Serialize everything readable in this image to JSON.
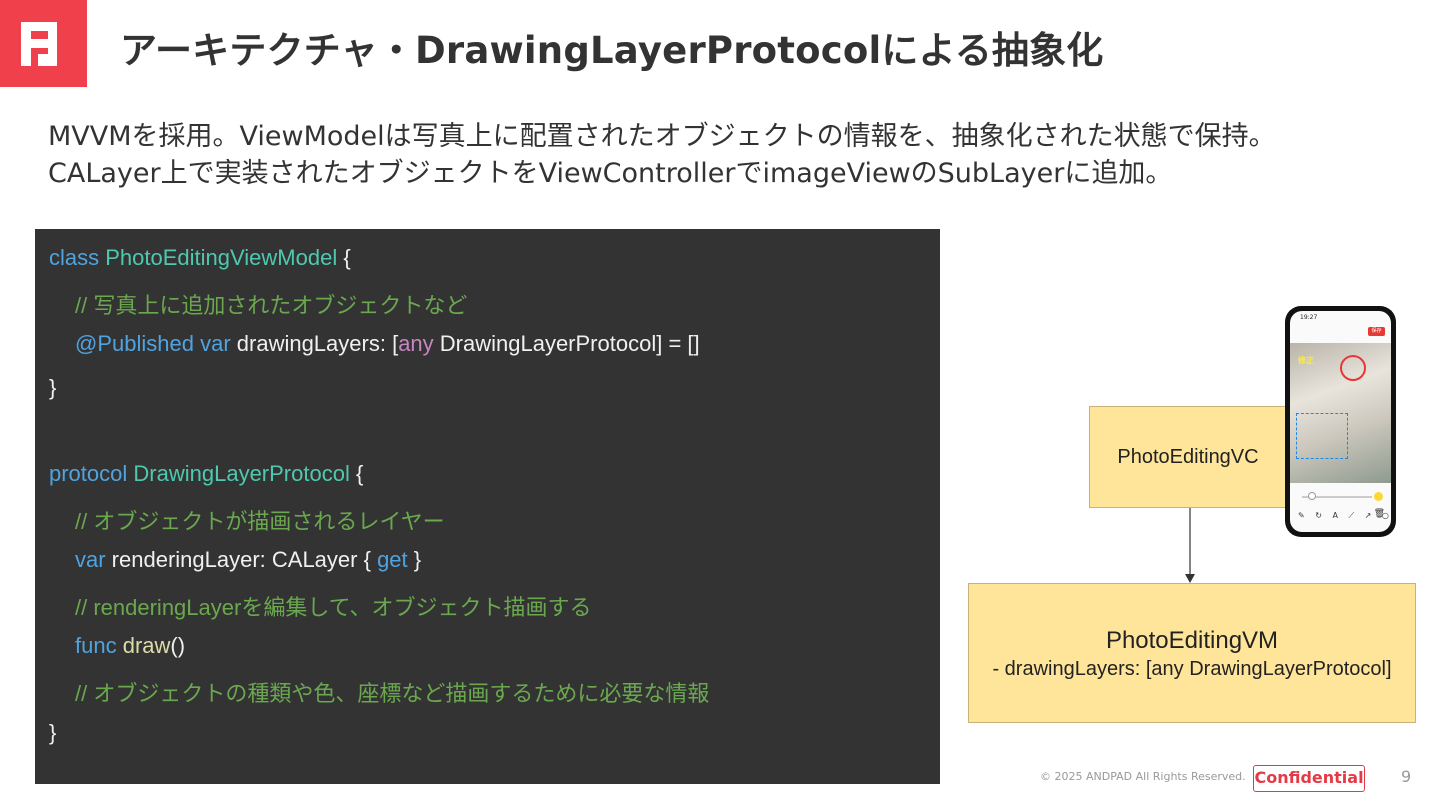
{
  "colors": {
    "brand": "#f0404c",
    "code_bg": "#333333",
    "box_fill": "#ffe599"
  },
  "logo": {
    "icon": "andpad-logo-icon"
  },
  "header": {
    "title": "アーキテクチャ・DrawingLayerProtocolによる抽象化"
  },
  "description": {
    "line1": "MVVMを採用。ViewModelは写真上に配置されたオブジェクトの情報を、抽象化された状態で保持。",
    "line2": "CALayer上で実装されたオブジェクトをViewControllerでimageViewのSubLayerに追加。"
  },
  "code": {
    "l1": {
      "kw": "class",
      "type": "PhotoEditingViewModel",
      "rest": " {"
    },
    "l2": {
      "comment": "// 写真上に追加されたオブジェクトなど"
    },
    "l3": {
      "attr": "@Published",
      "kw": "var",
      "name": " drawingLayers: [",
      "kw2": "any",
      "rest": " DrawingLayerProtocol] = []"
    },
    "l4": {
      "text": "}"
    },
    "l5": {
      "kw": "protocol",
      "type": "DrawingLayerProtocol",
      "rest": " {"
    },
    "l6": {
      "comment": "// オブジェクトが描画されるレイヤー"
    },
    "l7": {
      "kw": "var",
      "name": " renderingLayer: CALayer { ",
      "kw2": "get",
      "rest": " }"
    },
    "l8": {
      "comment": "// renderingLayerを編集して、オブジェクト描画する"
    },
    "l9": {
      "kw": "func",
      "fn": "draw",
      "rest": "()"
    },
    "l10": {
      "comment": "// オブジェクトの種類や色、座標など描画するために必要な情報"
    },
    "l11": {
      "text": "}"
    }
  },
  "diagram": {
    "vc_label": "PhotoEditingVC",
    "vm_label": "PhotoEditingVM",
    "vm_property": "- drawingLayers: [any DrawingLayerProtocol]"
  },
  "phone": {
    "time": "19:27",
    "save_label": "保存",
    "annotation_label": "修正",
    "tools": "✎ ↻ A ⟋ ↗ ○ □"
  },
  "footer": {
    "copyright": "© 2025 ANDPAD All Rights Reserved.",
    "badge": "Confidential",
    "page": "9"
  }
}
